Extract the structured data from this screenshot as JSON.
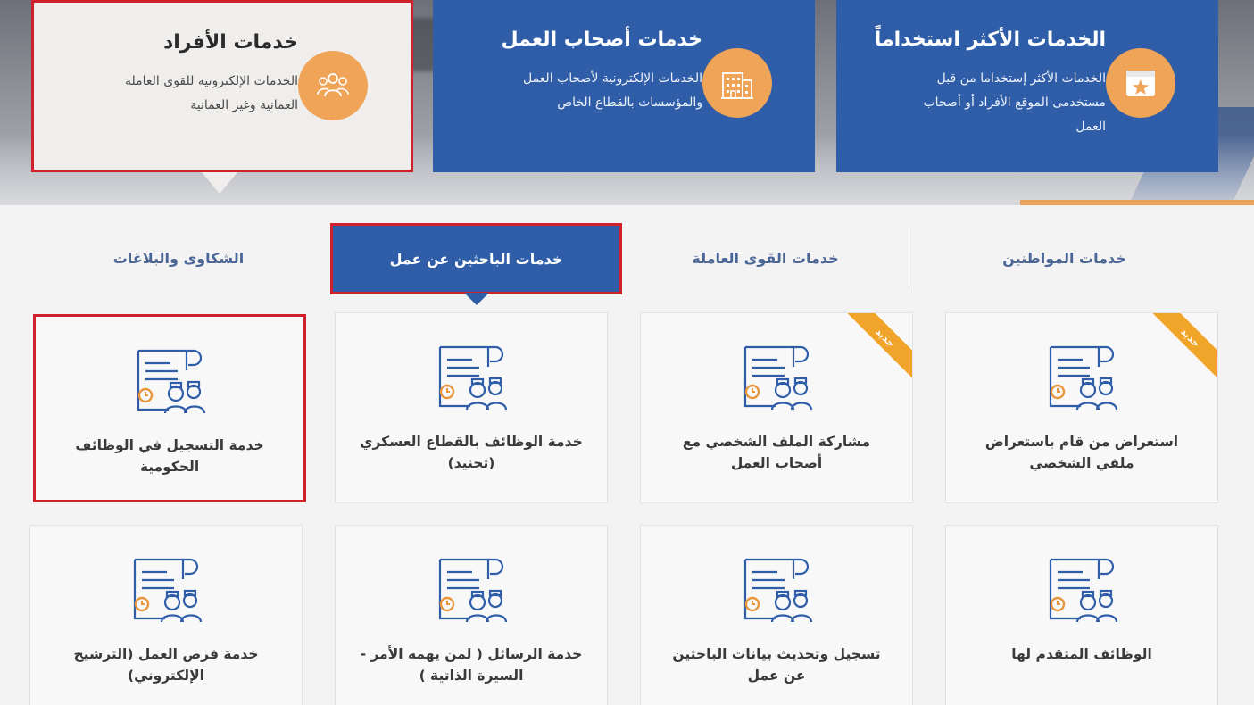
{
  "hero_cards": [
    {
      "title": "خدمات الأفراد",
      "desc_line1": "الخدمات الإلكترونية للقوى العاملة",
      "desc_line2": "العمانية وغير العمانية",
      "icon": "people-icon"
    },
    {
      "title": "خدمات أصحاب العمل",
      "desc_line1": "الخدمات الإلكترونية لأصحاب العمل",
      "desc_line2": "والمؤسسات بالقطاع الخاص",
      "icon": "building-icon"
    },
    {
      "title": "الخدمات الأكثر استخداماً",
      "desc_line1": "الخدمات الأكثر إستخداما من قبل",
      "desc_line2": "مستخدمى الموقع الأفراد أو أصحاب",
      "desc_line3": "العمل",
      "icon": "star-calendar-icon"
    }
  ],
  "tabs": {
    "complaints": "الشكاوى والبلاغات",
    "job_seekers": "خدمات الباحثين عن عمل",
    "workforce": "خدمات القوى العاملة",
    "citizens": "خدمات المواطنين"
  },
  "services": {
    "row1": [
      {
        "label": "خدمة التسجيل في الوظائف الحكومية"
      },
      {
        "label": "خدمة الوظائف بالقطاع العسكري (تجنيد)"
      },
      {
        "label": "مشاركة الملف الشخصي مع أصحاب العمل",
        "badge": "جديد"
      },
      {
        "label": "استعراض من قام باستعراض ملفي الشخصي",
        "badge": "جديد"
      }
    ],
    "row2": [
      {
        "label": "خدمة فرص العمل (الترشيح الإلكتروني)"
      },
      {
        "label": "خدمة الرسائل ( لمن يهمه الأمر - السيرة الذاتية )"
      },
      {
        "label": "تسجيل وتحديث بيانات الباحثين عن عمل"
      },
      {
        "label": "الوظائف المتقدم لها"
      }
    ]
  },
  "colors": {
    "blue": "#2f5da8",
    "orange": "#f0a458",
    "highlight_red": "#d0202b",
    "badge": "#f0a52a"
  }
}
